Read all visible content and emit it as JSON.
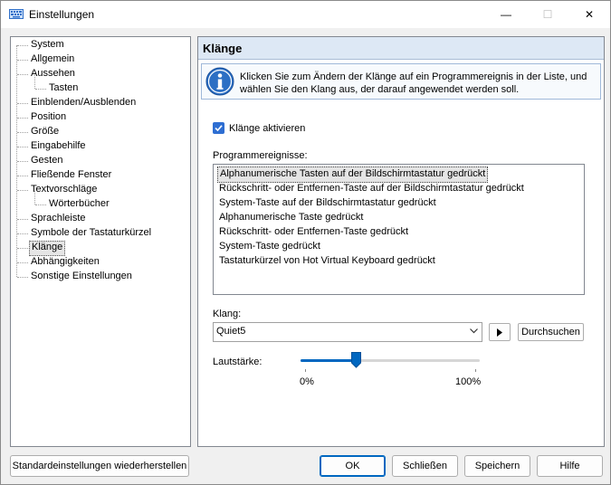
{
  "window": {
    "title": "Einstellungen",
    "minimize_glyph": "—",
    "maximize_glyph": "☐",
    "close_glyph": "✕",
    "app_icon": "keyboard-icon"
  },
  "tree": {
    "items": [
      {
        "label": "System",
        "level": 0
      },
      {
        "label": "Allgemein",
        "level": 0
      },
      {
        "label": "Aussehen",
        "level": 0
      },
      {
        "label": "Tasten",
        "level": 1
      },
      {
        "label": "Einblenden/Ausblenden",
        "level": 0
      },
      {
        "label": "Position",
        "level": 0
      },
      {
        "label": "Größe",
        "level": 0
      },
      {
        "label": "Eingabehilfe",
        "level": 0
      },
      {
        "label": "Gesten",
        "level": 0
      },
      {
        "label": "Fließende Fenster",
        "level": 0
      },
      {
        "label": "Textvorschläge",
        "level": 0
      },
      {
        "label": "Wörterbücher",
        "level": 1
      },
      {
        "label": "Sprachleiste",
        "level": 0
      },
      {
        "label": "Symbole der Tastaturkürzel",
        "level": 0
      },
      {
        "label": "Klänge",
        "level": 0,
        "selected": true
      },
      {
        "label": "Abhängigkeiten",
        "level": 0
      },
      {
        "label": "Sonstige Einstellungen",
        "level": 0
      }
    ]
  },
  "panel": {
    "title": "Klänge",
    "info_line1": "Klicken Sie zum Ändern der Klänge auf ein Programmereignis in der Liste, und",
    "info_line2": "wählen Sie den Klang aus, der darauf angewendet werden soll.",
    "enable_sounds_label": "Klänge aktivieren",
    "enable_sounds_checked": true,
    "events_label": "Programmereignisse:",
    "events": [
      "Alphanumerische Tasten auf der Bildschirmtastatur gedrückt",
      "Rückschritt- oder Entfernen-Taste auf der Bildschirmtastatur gedrückt",
      "System-Taste auf der Bildschirmtastatur gedrückt",
      "Alphanumerische Taste gedrückt",
      "Rückschritt- oder Entfernen-Taste gedrückt",
      "System-Taste gedrückt",
      "Tastaturkürzel von Hot Virtual Keyboard gedrückt"
    ],
    "selected_event_index": 0,
    "sound_label": "Klang:",
    "sound_value": "Quiet5",
    "browse_label": "Durchsuchen",
    "volume_label": "Lautstärke:",
    "volume_min_label": "0%",
    "volume_max_label": "100%",
    "volume_fraction": 0.31
  },
  "buttons": {
    "restore_defaults": "Standardeinstellungen wiederherstellen",
    "ok": "OK",
    "close": "Schließen",
    "save": "Speichern",
    "help": "Hilfe"
  },
  "colors": {
    "accent": "#0067c0",
    "checkbox": "#2e6ed2",
    "panel_header": "#dde8f5"
  }
}
